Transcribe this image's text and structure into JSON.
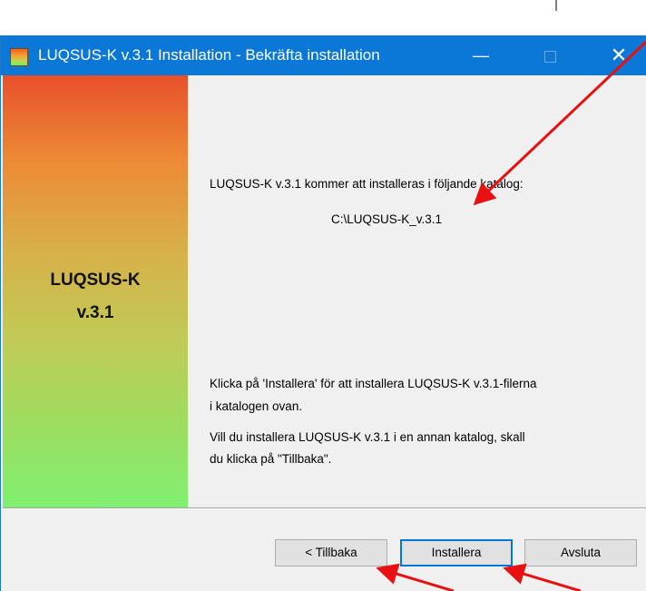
{
  "window": {
    "title": "LUQSUS-K v.3.1 Installation - Bekräfta installation",
    "controls": {
      "minimize": "—",
      "close": "✕"
    }
  },
  "sidebar": {
    "name_line1": "LUQSUS-K",
    "name_line2": "v.3.1"
  },
  "main": {
    "intro": "LUQSUS-K v.3.1 kommer att installeras i följande katalog:",
    "path": "C:\\LUQSUS-K_v.3.1",
    "instruction_line1": "Klicka på 'Installera' för att installera LUQSUS-K v.3.1-filerna",
    "instruction_line2": "i katalogen ovan.",
    "alt_line1": "Vill du installera LUQSUS-K v.3.1 i en annan katalog, skall",
    "alt_line2": "du klicka på \"Tillbaka\"."
  },
  "buttons": {
    "back": "< Tillbaka",
    "install": "Installera",
    "exit": "Avsluta"
  },
  "colors": {
    "titlebar": "#0b78d7",
    "annotation_arrow": "#e81010"
  }
}
